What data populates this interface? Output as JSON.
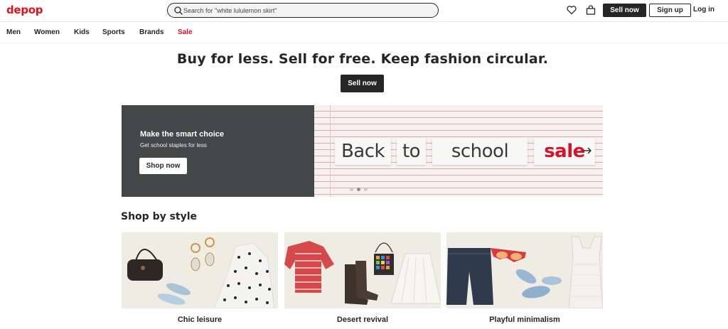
{
  "header": {
    "logo": "depop",
    "search_placeholder": "Search for \"white lululemon skirt\"",
    "sell_now": "Sell now",
    "sign_up": "Sign up",
    "log_in": "Log in"
  },
  "nav": {
    "items": [
      "Men",
      "Women",
      "Kids",
      "Sports",
      "Brands",
      "Sale"
    ]
  },
  "hero": {
    "headline": "Buy for less. Sell for free. Keep fashion circular.",
    "cta": "Sell now"
  },
  "banner": {
    "title": "Make the smart choice",
    "subtitle": "Get school staples for less",
    "cta": "Shop now",
    "words": [
      "Back",
      "to",
      "school",
      "sale"
    ],
    "dots_active_index": 1,
    "dot_count": 3
  },
  "shop_by_style": {
    "title": "Shop by style",
    "tiles": [
      {
        "label": "Chic leisure"
      },
      {
        "label": "Desert revival"
      },
      {
        "label": "Playful minimalism"
      }
    ]
  },
  "colors": {
    "brand_red": "#e3101e",
    "dark": "#262626",
    "banner_dark": "#444748",
    "tile_bg": "#eeece3"
  }
}
